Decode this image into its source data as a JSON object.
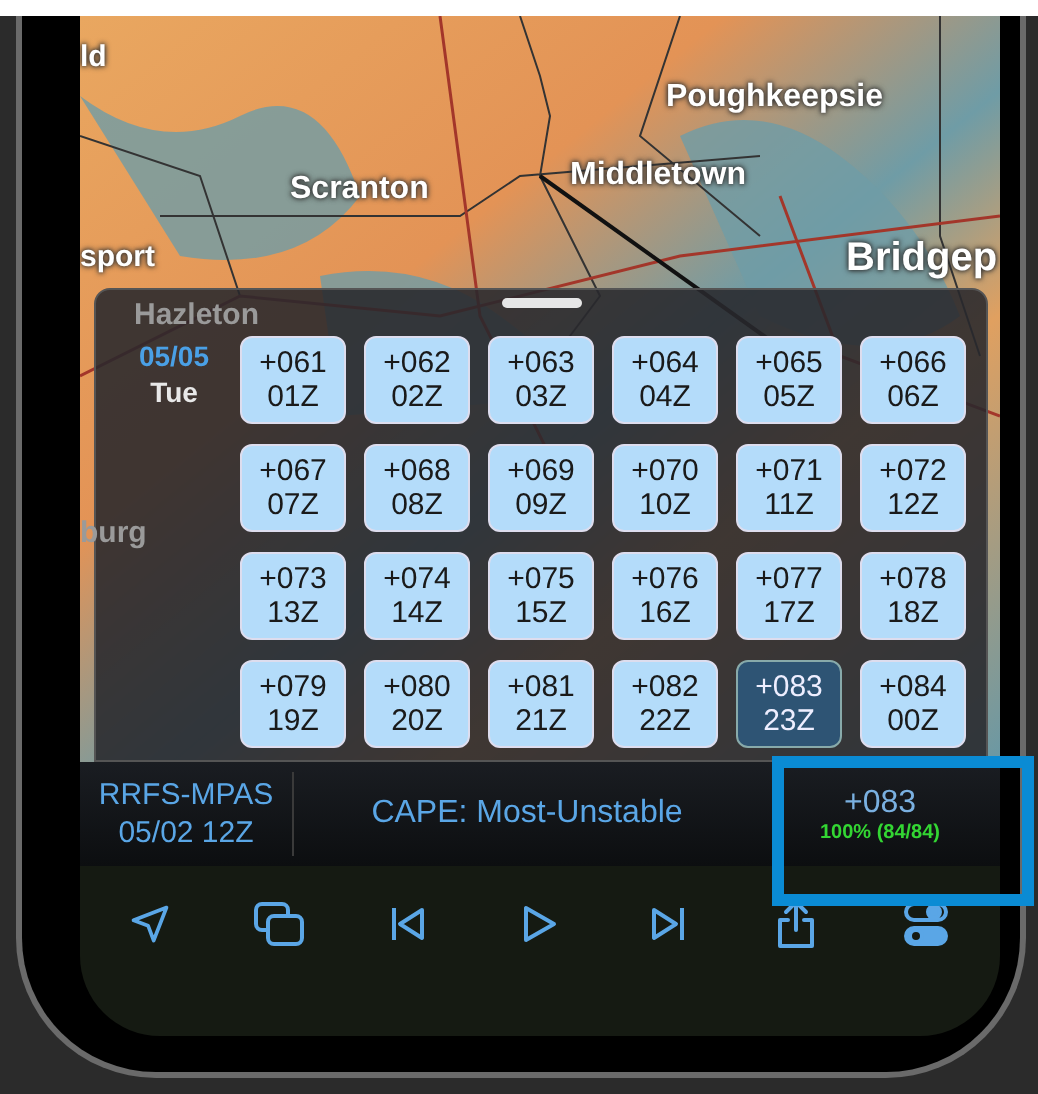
{
  "map": {
    "labels": [
      {
        "text": "ld",
        "kind": "town"
      },
      {
        "text": "Poughkeepsie",
        "kind": "city"
      },
      {
        "text": "Scranton",
        "kind": "city"
      },
      {
        "text": "Middletown",
        "kind": "city"
      },
      {
        "text": "sport",
        "kind": "town"
      },
      {
        "text": "Bridgep",
        "kind": "big"
      },
      {
        "text": "Hazleton",
        "kind": "faded"
      },
      {
        "text": "burg",
        "kind": "faded"
      }
    ]
  },
  "picker": {
    "date": "05/05",
    "weekday": "Tue",
    "hours": [
      {
        "offset": "+061",
        "time": "01Z",
        "selected": false
      },
      {
        "offset": "+062",
        "time": "02Z",
        "selected": false
      },
      {
        "offset": "+063",
        "time": "03Z",
        "selected": false
      },
      {
        "offset": "+064",
        "time": "04Z",
        "selected": false
      },
      {
        "offset": "+065",
        "time": "05Z",
        "selected": false
      },
      {
        "offset": "+066",
        "time": "06Z",
        "selected": false
      },
      {
        "offset": "+067",
        "time": "07Z",
        "selected": false
      },
      {
        "offset": "+068",
        "time": "08Z",
        "selected": false
      },
      {
        "offset": "+069",
        "time": "09Z",
        "selected": false
      },
      {
        "offset": "+070",
        "time": "10Z",
        "selected": false
      },
      {
        "offset": "+071",
        "time": "11Z",
        "selected": false
      },
      {
        "offset": "+072",
        "time": "12Z",
        "selected": false
      },
      {
        "offset": "+073",
        "time": "13Z",
        "selected": false
      },
      {
        "offset": "+074",
        "time": "14Z",
        "selected": false
      },
      {
        "offset": "+075",
        "time": "15Z",
        "selected": false
      },
      {
        "offset": "+076",
        "time": "16Z",
        "selected": false
      },
      {
        "offset": "+077",
        "time": "17Z",
        "selected": false
      },
      {
        "offset": "+078",
        "time": "18Z",
        "selected": false
      },
      {
        "offset": "+079",
        "time": "19Z",
        "selected": false
      },
      {
        "offset": "+080",
        "time": "20Z",
        "selected": false
      },
      {
        "offset": "+081",
        "time": "21Z",
        "selected": false
      },
      {
        "offset": "+082",
        "time": "22Z",
        "selected": false
      },
      {
        "offset": "+083",
        "time": "23Z",
        "selected": true
      },
      {
        "offset": "+084",
        "time": "00Z",
        "selected": false
      }
    ]
  },
  "info_bar": {
    "model": "RRFS-MPAS",
    "run": "05/02 12Z",
    "parameter": "CAPE: Most-Unstable",
    "frame": "+083",
    "progress": "100% (84/84)",
    "complete": true,
    "highlighted": true
  },
  "toolbar": [
    {
      "kind": "locate"
    },
    {
      "kind": "layers"
    },
    {
      "kind": "first"
    },
    {
      "kind": "play"
    },
    {
      "kind": "last"
    },
    {
      "kind": "share"
    },
    {
      "kind": "toggles"
    }
  ]
}
